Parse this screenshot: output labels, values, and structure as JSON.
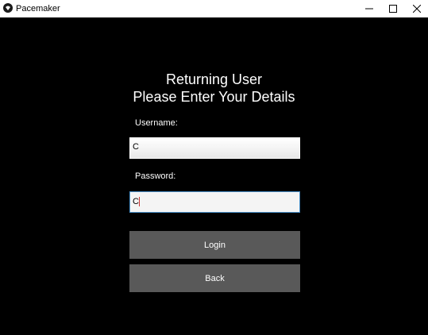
{
  "window": {
    "title": "Pacemaker",
    "icon": "app-logo-icon",
    "controls": {
      "minimize_icon": "minimize-icon",
      "maximize_icon": "maximize-icon",
      "close_icon": "close-icon"
    }
  },
  "form": {
    "heading_line1": "Returning User",
    "heading_line2": "Please Enter Your Details",
    "username_label": "Username:",
    "username_value": "C",
    "password_label": "Password:",
    "password_value": "C",
    "login_label": "Login",
    "back_label": "Back"
  },
  "colors": {
    "background": "#000000",
    "button_bg": "#595959",
    "focus_border": "#4a90c8",
    "text": "#ffffff"
  }
}
